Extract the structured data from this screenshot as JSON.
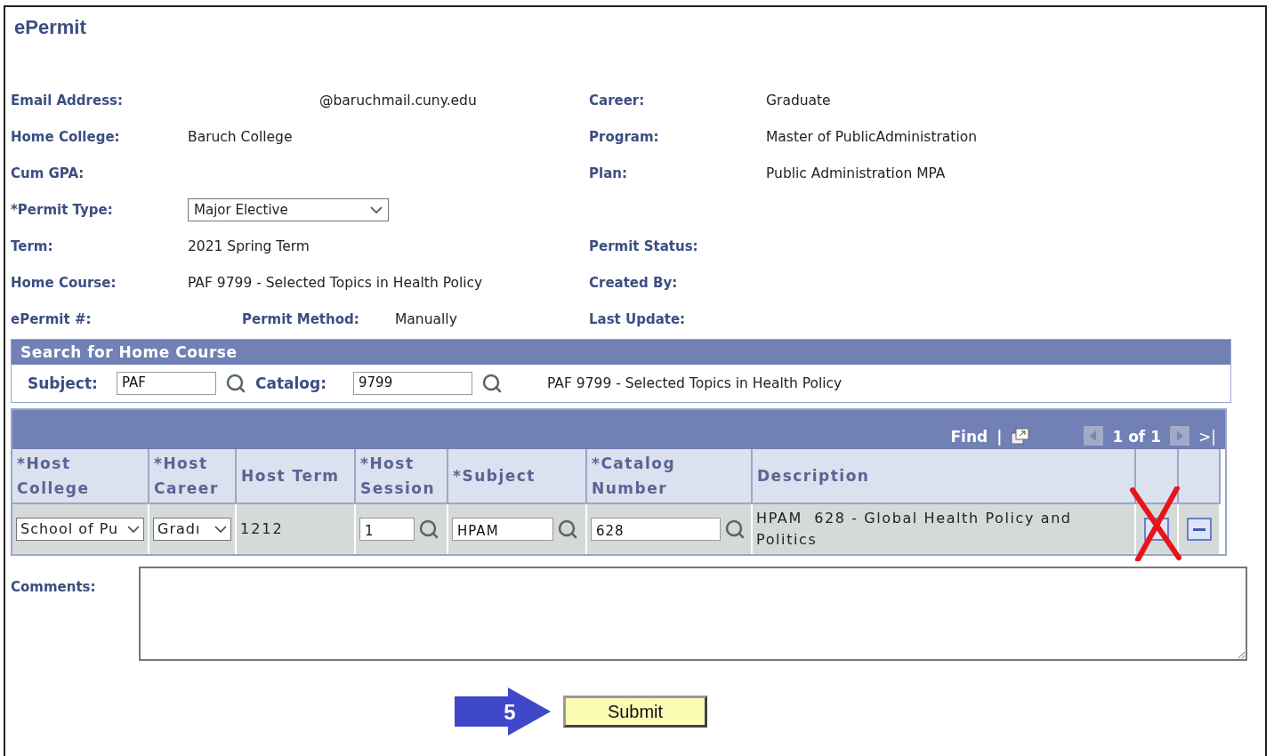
{
  "page_title": "ePermit",
  "info_rows": [
    {
      "left": {
        "label": "Email Address:",
        "value": "@baruchmail.cuny.edu",
        "kind": "offset"
      },
      "right": {
        "label": "Career:",
        "value": "Graduate"
      }
    },
    {
      "left": {
        "label": "Home College:",
        "value": "Baruch College",
        "kind": "text"
      },
      "right": {
        "label": "Program:",
        "value": "Master of PublicAdministration"
      }
    },
    {
      "left": {
        "label": "Cum GPA:",
        "kind": "text"
      },
      "right": {
        "label": "Plan:",
        "value": "Public Administration MPA"
      }
    },
    {
      "left": {
        "label": "*Permit Type:",
        "value": "Major Elective",
        "kind": "select"
      }
    },
    {
      "left": {
        "label": "Term:",
        "value": "2021 Spring Term",
        "kind": "text"
      },
      "right": {
        "label": "Permit Status:"
      }
    },
    {
      "left": {
        "label": "Home Course:",
        "value": "PAF 9799 - Selected Topics in Health Policy",
        "kind": "text"
      },
      "right": {
        "label": "Created By:"
      }
    },
    {
      "left": {
        "label": "ePermit #:",
        "sublabel": "Permit Method:",
        "value": "Manually",
        "kind": "method"
      },
      "right": {
        "label": "Last Update:"
      }
    }
  ],
  "search": {
    "title": "Search for Home Course",
    "subject_label": "Subject:",
    "subject_value": "PAF",
    "catalog_label": "Catalog:",
    "catalog_value": "9799",
    "result": "PAF 9799 - Selected Topics in Health Policy"
  },
  "grid": {
    "find": "Find",
    "separator": "|",
    "pager": "1 of 1",
    "last": ">|",
    "columns": [
      "*Host College",
      "*Host Career",
      "Host Term",
      "*Host Session",
      "*Subject",
      "*Catalog Number",
      "Description"
    ],
    "rows": [
      {
        "host_college": "School of Pu",
        "host_career": "Gradı",
        "host_term": "1212",
        "host_session": "1",
        "subject": "HPAM",
        "catalog_number": "628",
        "description": "HPAM  628 - Global Health Policy and Politics"
      }
    ]
  },
  "comments": {
    "label": "Comments:"
  },
  "step_marker": "5",
  "submit": "Submit"
}
